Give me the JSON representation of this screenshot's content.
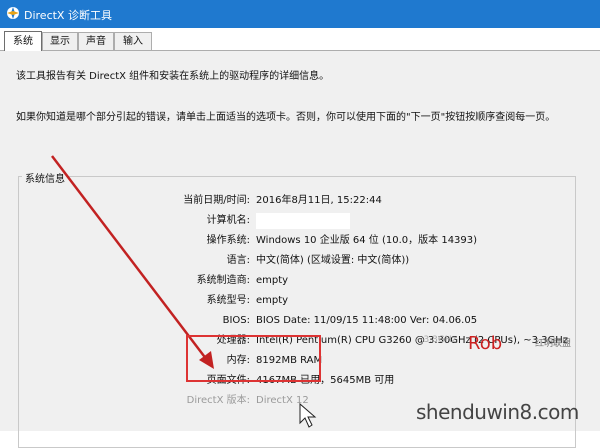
{
  "window": {
    "title": "DirectX 诊断工具"
  },
  "tabs": [
    {
      "label": "系统",
      "active": true
    },
    {
      "label": "显示",
      "active": false
    },
    {
      "label": "声音",
      "active": false
    },
    {
      "label": "输入",
      "active": false
    }
  ],
  "intro": {
    "line1": "该工具报告有关 DirectX 组件和安装在系统上的驱动程序的详细信息。",
    "line2": "如果你知道是哪个部分引起的错误，请单击上面适当的选项卡。否则，你可以使用下面的\"下一页\"按钮按顺序查阅每一页。"
  },
  "system_info": {
    "title": "系统信息",
    "rows": [
      {
        "label": "当前日期/时间:",
        "value": "2016年8月11日, 15:22:44"
      },
      {
        "label": "计算机名:",
        "value": ""
      },
      {
        "label": "操作系统:",
        "value": "Windows 10 企业版 64 位 (10.0，版本 14393)"
      },
      {
        "label": "语言:",
        "value": "中文(简体) (区域设置: 中文(简体))"
      },
      {
        "label": "系统制造商:",
        "value": "empty"
      },
      {
        "label": "系统型号:",
        "value": "empty"
      },
      {
        "label": "BIOS:",
        "value": "BIOS Date: 11/09/15 11:48:00 Ver: 04.06.05"
      },
      {
        "label": "处理器:",
        "value": "Intel(R) Pentium(R) CPU G3260 @ 3.30GHz (2 CPUs), ~3.3GHz"
      },
      {
        "label": "内存:",
        "value": "8192MB RAM"
      },
      {
        "label": "页面文件:",
        "value": "4167MB 已用，5645MB 可用"
      },
      {
        "label": "DirectX 版本:",
        "value": "DirectX 12"
      }
    ]
  },
  "watermark": {
    "ghost": "~3.3GHz",
    "site": "shenduwin8.com",
    "badge": "Rob",
    "small": "红明联盟"
  },
  "colors": {
    "titlebar": "#1f79cf",
    "arrow": "#c22222",
    "highlight": "#dd3333"
  }
}
